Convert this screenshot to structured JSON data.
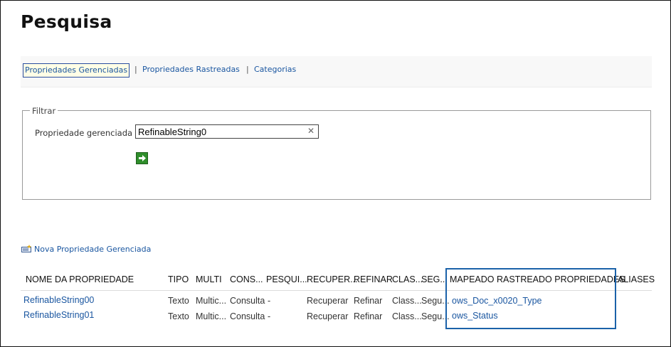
{
  "page_title": "Pesquisa",
  "tabs": [
    {
      "label": "Propriedades Gerenciadas",
      "active": true
    },
    {
      "label": "Propriedades Rastreadas",
      "active": false
    },
    {
      "label": "Categorias",
      "active": false
    }
  ],
  "tab_separator": "|",
  "filter": {
    "legend": "Filtrar",
    "field_label": "Propriedade gerenciada",
    "field_value": "RefinableString0",
    "clear_icon": "close-icon",
    "go_icon": "arrow-right-icon"
  },
  "new_property_link": "Nova Propriedade Gerenciada",
  "table": {
    "columns": [
      "NOME DA PROPRIEDADE",
      "TIPO",
      "MULTI",
      "CONS...",
      "PESQUI...",
      "RECUPER...",
      "REFINAR",
      "CLAS...",
      "SEG...",
      "MAPEADO RASTREADO PROPRIEDADES",
      "ALIASES"
    ],
    "rows": [
      {
        "name": "RefinableString00",
        "tipo": "Texto",
        "multi": "Multic...",
        "cons": "Consulta",
        "pesqui": "-",
        "recuper": "Recuperar",
        "refinar": "Refinar",
        "clas": "Class...",
        "seg": "Segu...",
        "mapeado": "ows_Doc_x0020_Type",
        "aliases": ""
      },
      {
        "name": "RefinableString01",
        "tipo": "Texto",
        "multi": "Multic...",
        "cons": "Consulta",
        "pesqui": "-",
        "recuper": "Recuperar",
        "refinar": "Refinar",
        "clas": "Class...",
        "seg": "Segu...",
        "mapeado": "ows_Status",
        "aliases": ""
      }
    ]
  },
  "colors": {
    "link": "#1a56a0",
    "highlight_border": "#1b62a9",
    "go_button": "#2f8e2b"
  }
}
